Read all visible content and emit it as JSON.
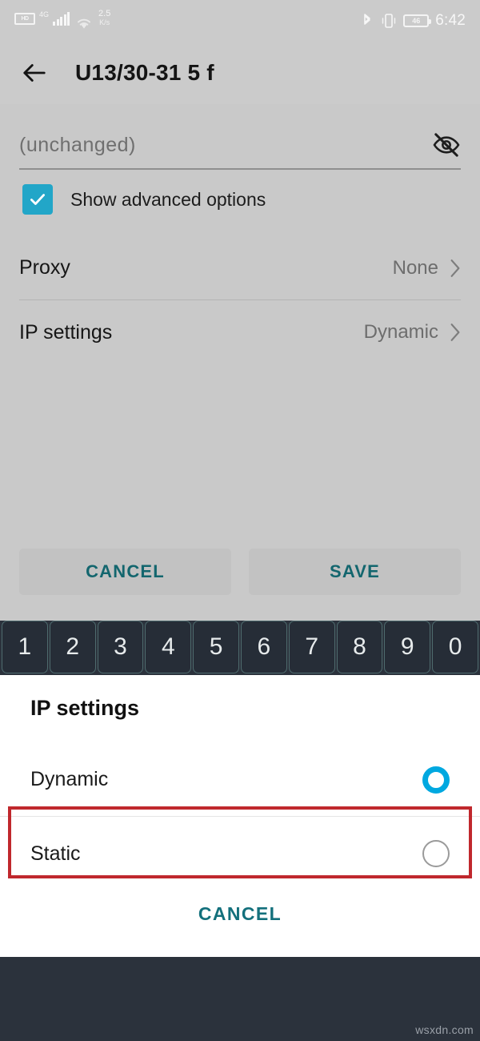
{
  "status_bar": {
    "hd_badge": "HD",
    "network_type": "4G",
    "data_speed_value": "2.5",
    "data_speed_unit": "K/s",
    "signal_icon": "signal-bars-icon",
    "wifi_icon": "wifi-icon",
    "bluetooth_icon": "bluetooth-icon",
    "vibrate_icon": "vibrate-icon",
    "battery_level": "46",
    "time": "6:42"
  },
  "app_bar": {
    "back_icon": "back-arrow-icon",
    "title": "U13/30-31 5 f"
  },
  "form": {
    "password_value": "(unchanged)",
    "password_placeholder": "(unchanged)",
    "visibility_icon": "eye-off-icon",
    "advanced_checkbox_label": "Show advanced options",
    "advanced_checkbox_checked": "true",
    "rows": [
      {
        "label": "Proxy",
        "value": "None",
        "chevron": "chevron-right-icon"
      },
      {
        "label": "IP settings",
        "value": "Dynamic",
        "chevron": "chevron-right-icon"
      }
    ],
    "cancel_label": "CANCEL",
    "save_label": "SAVE"
  },
  "keyboard": {
    "number_keys": [
      "1",
      "2",
      "3",
      "4",
      "5",
      "6",
      "7",
      "8",
      "9",
      "0"
    ]
  },
  "dialog": {
    "title": "IP settings",
    "options": [
      {
        "label": "Dynamic",
        "selected": "true"
      },
      {
        "label": "Static",
        "selected": "false"
      }
    ],
    "cancel_label": "CANCEL",
    "highlight_color": "#c0282d",
    "highlighted_option": "Static"
  },
  "system": {
    "home_indicator": "home-indicator-pill",
    "watermark": "wsxdn.com"
  },
  "colors": {
    "background": "#cbcbcb",
    "accent_teal": "#13707c",
    "checkbox_teal": "#22a6c8",
    "radio_selected": "#00a8e0",
    "keyboard_bg": "#2b323c",
    "highlight_red": "#c0282d"
  }
}
